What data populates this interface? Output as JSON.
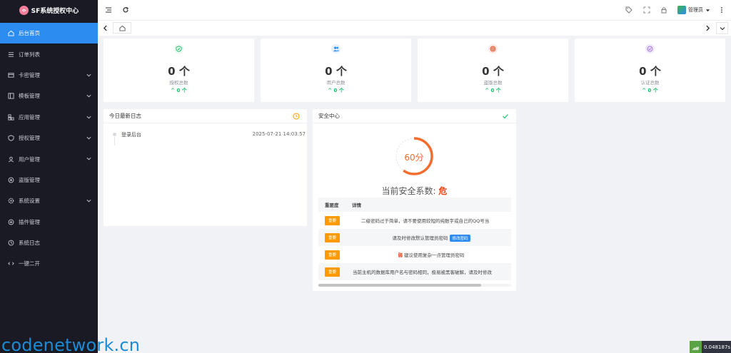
{
  "brand": {
    "title": "SF系统授权中心"
  },
  "sidebar": {
    "items": [
      {
        "label": "后台首页",
        "icon": "home-icon",
        "has_children": false,
        "active": true
      },
      {
        "label": "订单列表",
        "icon": "list-icon",
        "has_children": false
      },
      {
        "label": "卡密管理",
        "icon": "card-icon",
        "has_children": true
      },
      {
        "label": "模板管理",
        "icon": "template-icon",
        "has_children": true
      },
      {
        "label": "应用管理",
        "icon": "app-icon",
        "has_children": true
      },
      {
        "label": "授权管理",
        "icon": "shield-icon",
        "has_children": true
      },
      {
        "label": "用户管理",
        "icon": "user-icon",
        "has_children": true
      },
      {
        "label": "盗版管理",
        "icon": "pirate-icon",
        "has_children": false
      },
      {
        "label": "系统设置",
        "icon": "gear-icon",
        "has_children": true
      },
      {
        "label": "插件管理",
        "icon": "plugin-icon",
        "has_children": false
      },
      {
        "label": "系统日志",
        "icon": "clock-icon",
        "has_children": false
      },
      {
        "label": "一键二开",
        "icon": "code-icon",
        "has_children": false
      }
    ]
  },
  "header": {
    "user_label": "管理员"
  },
  "stats": [
    {
      "value": "0 个",
      "label": "授权总数",
      "trend": "0 个",
      "color": "#19be6b",
      "icon": "shield-check-icon"
    },
    {
      "value": "0 个",
      "label": "用户总数",
      "trend": "0 个",
      "color": "#2d8cf0",
      "icon": "users-icon"
    },
    {
      "value": "0 个",
      "label": "盗版总数",
      "trend": "0 个",
      "color": "#ed4014",
      "icon": "target-icon"
    },
    {
      "value": "0 个",
      "label": "认证总数",
      "trend": "0 个",
      "color": "#9a66e4",
      "icon": "verified-icon"
    }
  ],
  "log_panel": {
    "title": "今日最新日志",
    "items": [
      {
        "text": "登录后台",
        "time": "2025-07-21 14:03:57"
      }
    ]
  },
  "security": {
    "title": "安全中心",
    "score_text": "60分",
    "score": 60,
    "status_prefix": "当前安全系数:",
    "status_level": "危",
    "table_headers": [
      "重要度",
      "详情"
    ],
    "rows": [
      {
        "badge": "重要",
        "detail": "二级密码过于简单，请不要使用较短的纯数字或自己的QQ号当"
      },
      {
        "badge": "重要",
        "detail": "请及时修改默认管理员密码",
        "button": "修改密码"
      },
      {
        "badge": "重要",
        "detail": "建议使用复杂一点管理员密码",
        "prefix_mark": "弱"
      },
      {
        "badge": "重要",
        "detail": "当前主机的数据库用户名与密码相同，极易被黑客破解，请及时修改"
      }
    ]
  },
  "watermark": "codenetwork.cn",
  "timer": "0.048187s"
}
